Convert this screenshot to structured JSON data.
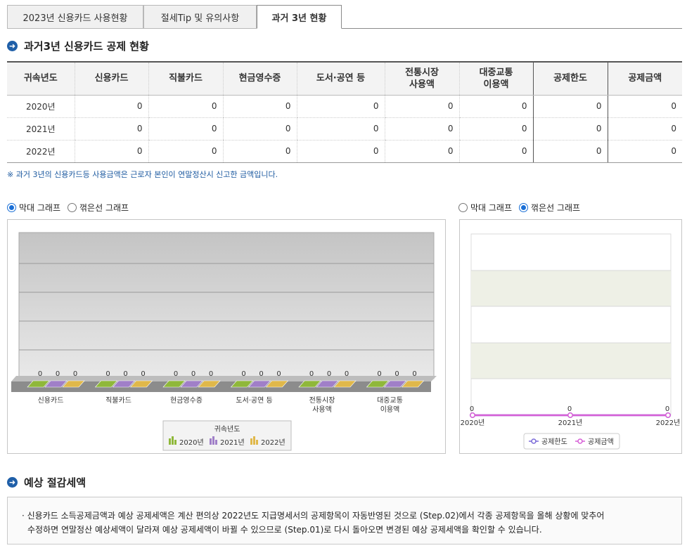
{
  "tabs": [
    {
      "label": "2023년 신용카드 사용현황",
      "active": false
    },
    {
      "label": "절세Tip 및 유의사항",
      "active": false
    },
    {
      "label": "과거 3년 현황",
      "active": true
    }
  ],
  "section1": {
    "title": "과거3년 신용카드 공제 현황"
  },
  "table": {
    "headers": [
      "귀속년도",
      "신용카드",
      "직불카드",
      "현금영수증",
      "도서·공연 등",
      "전통시장|사용액",
      "대중교통|이용액",
      "공제한도",
      "공제금액"
    ],
    "rows": [
      [
        "2020년",
        "0",
        "0",
        "0",
        "0",
        "0",
        "0",
        "0",
        "0"
      ],
      [
        "2021년",
        "0",
        "0",
        "0",
        "0",
        "0",
        "0",
        "0",
        "0"
      ],
      [
        "2022년",
        "0",
        "0",
        "0",
        "0",
        "0",
        "0",
        "0",
        "0"
      ]
    ]
  },
  "note": "※ 과거 3년의 신용카드등 사용금액은 근로자 본인이 연말정산시 신고한 금액입니다.",
  "left_chart_controls": {
    "bar": "막대 그래프",
    "line": "꺾은선 그래프",
    "selected": "bar"
  },
  "right_chart_controls": {
    "bar": "막대 그래프",
    "line": "꺾은선 그래프",
    "selected": "line"
  },
  "chart_data": [
    {
      "type": "bar",
      "categories": [
        "신용카드",
        "직불카드",
        "현금영수증",
        "도서·공연 등",
        "전통시장|사용액",
        "대중교통|이용액"
      ],
      "series": [
        {
          "name": "2020년",
          "values": [
            0,
            0,
            0,
            0,
            0,
            0
          ],
          "color": "#8fb83a"
        },
        {
          "name": "2021년",
          "values": [
            0,
            0,
            0,
            0,
            0,
            0
          ],
          "color": "#a07fc8"
        },
        {
          "name": "2022년",
          "values": [
            0,
            0,
            0,
            0,
            0,
            0
          ],
          "color": "#e0b84a"
        }
      ],
      "legend_title": "귀속년도",
      "legend_position": "bottom",
      "grid": true
    },
    {
      "type": "line",
      "x": [
        "2020년",
        "2021년",
        "2022년"
      ],
      "series": [
        {
          "name": "공제한도",
          "values": [
            0,
            0,
            0
          ],
          "color": "#7a6ad8"
        },
        {
          "name": "공제금액",
          "values": [
            0,
            0,
            0
          ],
          "color": "#d65fd6"
        }
      ],
      "legend_position": "bottom",
      "grid": true
    }
  ],
  "section2": {
    "title": "예상 절감세액"
  },
  "notice": {
    "line1": "· 신용카드 소득공제금액과 예상 공제세액은 계산 편의상 2022년도 지급명세서의 공제항목이 자동반영된 것으로 (Step.02)에서 각종 공제항목을 올해 상황에 맞추어",
    "line2": "수정하면 연말정산 예상세액이 달라져 예상 공제세액이 바뀔 수 있으므로 (Step.01)로 다시 돌아오면 변경된 예상 공제세액을 확인할 수 있습니다."
  }
}
